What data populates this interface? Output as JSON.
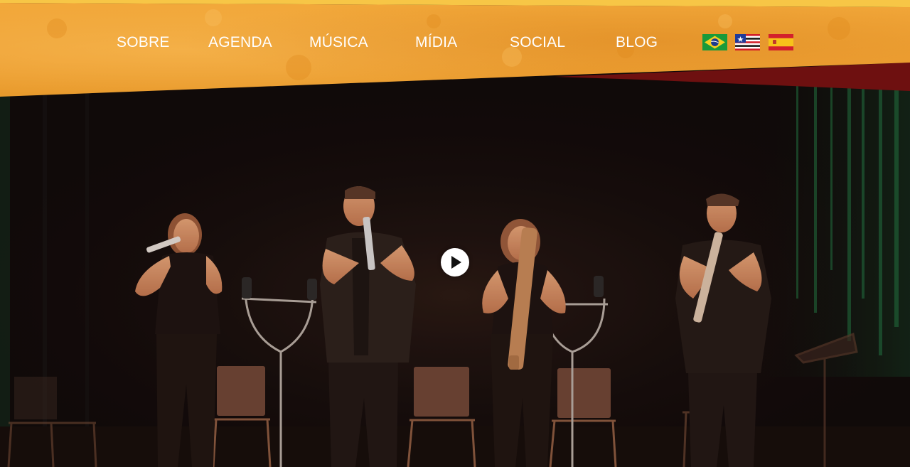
{
  "nav": {
    "items": [
      {
        "label": "SOBRE"
      },
      {
        "label": "AGENDA"
      },
      {
        "label": "MÚSICA"
      },
      {
        "label": "MÍDIA"
      },
      {
        "label": "SOCIAL"
      },
      {
        "label": "BLOG"
      }
    ]
  },
  "languages": [
    {
      "icon": "brazil-flag-icon"
    },
    {
      "icon": "maranhao-flag-icon"
    },
    {
      "icon": "spain-flag-icon"
    }
  ],
  "video": {
    "play_icon": "play-icon"
  },
  "colors": {
    "header_orange": "#f0a030",
    "header_dark_orange": "#e08a1e",
    "accent_red": "#6e1010",
    "top_stripe_yellow": "#f7c646",
    "nav_text": "#ffffff",
    "stage_background": "#0b0809"
  }
}
